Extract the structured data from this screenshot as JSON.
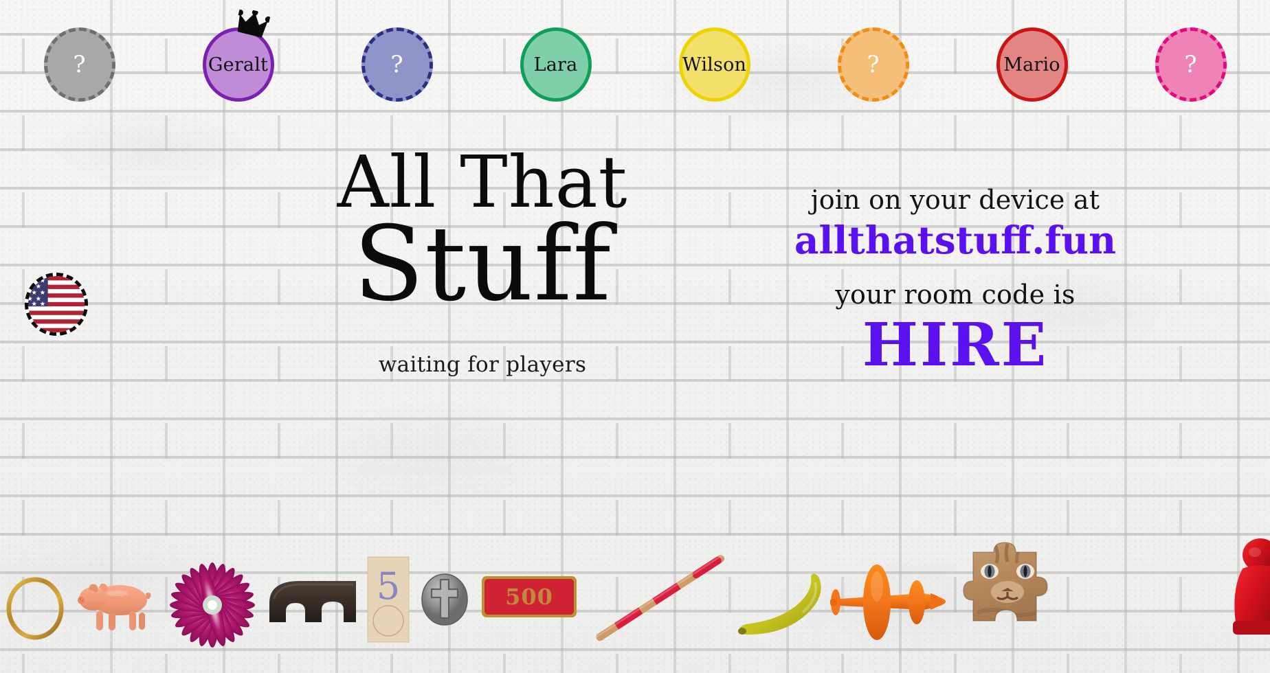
{
  "app": {
    "title_line_1": "All That",
    "title_line_2": "Stuff",
    "status": "waiting for players"
  },
  "join": {
    "prompt": "join on your device at",
    "url": "allthatstuff.fun",
    "code_label": "your room code is",
    "code": "HIRE",
    "accent_color": "#5b10f0"
  },
  "language": {
    "name": "flag-usa-icon",
    "label": "United States"
  },
  "players": [
    {
      "slot": 1,
      "name": "?",
      "state": "empty",
      "fill": "#a8a8a8",
      "border": "#6f6f6f",
      "host": false
    },
    {
      "slot": 2,
      "name": "Geralt",
      "state": "taken",
      "fill": "#c08cd8",
      "border": "#7b21b0",
      "host": true
    },
    {
      "slot": 3,
      "name": "?",
      "state": "empty",
      "fill": "#8f95c8",
      "border": "#2b2f86",
      "host": false
    },
    {
      "slot": 4,
      "name": "Lara",
      "state": "taken",
      "fill": "#7fcfa8",
      "border": "#0f9f5b",
      "host": false
    },
    {
      "slot": 5,
      "name": "Wilson",
      "state": "taken",
      "fill": "#f2e06a",
      "border": "#ecd400",
      "host": false
    },
    {
      "slot": 6,
      "name": "?",
      "state": "empty",
      "fill": "#f5bf7a",
      "border": "#f08c16",
      "host": false
    },
    {
      "slot": 7,
      "name": "Mario",
      "state": "taken",
      "fill": "#e38585",
      "border": "#cb1414",
      "host": false
    },
    {
      "slot": 8,
      "name": "?",
      "state": "empty",
      "fill": "#ef83b5",
      "border": "#e0097e",
      "host": false
    }
  ],
  "objects": [
    {
      "name": "gold-ring-object",
      "label": "gold ring"
    },
    {
      "name": "pink-pig-object",
      "label": "pink toy pig"
    },
    {
      "name": "purple-flower-object",
      "label": "magenta flower"
    },
    {
      "name": "brown-arch-object",
      "label": "dark brown arch block"
    },
    {
      "name": "number-five-card-object",
      "label": "card with number 5",
      "value": "5"
    },
    {
      "name": "cross-coin-object",
      "label": "silver cross coin"
    },
    {
      "name": "money-tile-object",
      "label": "red 500 money tile",
      "value": "500"
    },
    {
      "name": "striped-stick-object",
      "label": "red striped wooden stick"
    },
    {
      "name": "banana-object",
      "label": "toy banana"
    },
    {
      "name": "orange-plane-object",
      "label": "orange toy airplane"
    },
    {
      "name": "cat-puzzle-piece-object",
      "label": "jigsaw piece with cat"
    },
    {
      "name": "red-figurine-object",
      "label": "red figurine"
    }
  ]
}
